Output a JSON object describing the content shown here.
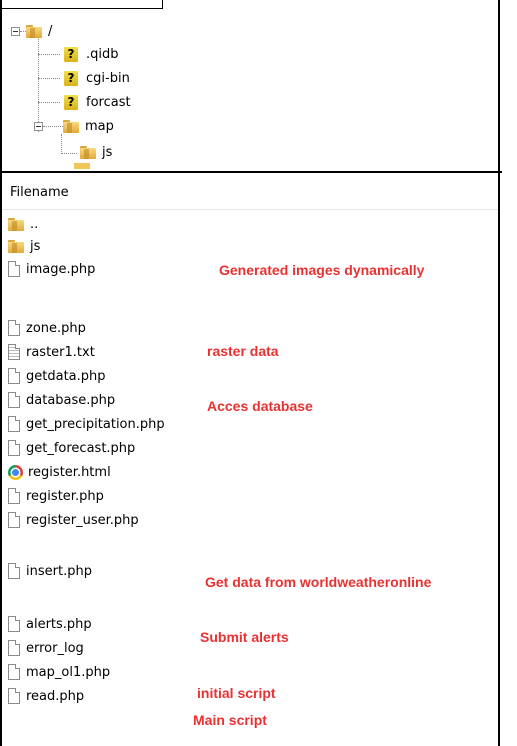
{
  "tree": {
    "root": "/",
    "items": [
      ".qidb",
      "cgi-bin",
      "forcast",
      "map",
      "js"
    ]
  },
  "list": {
    "header": "Filename",
    "files": [
      "..",
      "js",
      "image.php",
      "zone.php",
      "raster1.txt",
      "getdata.php",
      "database.php",
      "get_precipitation.php",
      "get_forecast.php",
      "register.html",
      "register.php",
      "register_user.php",
      "insert.php",
      "alerts.php",
      "error_log",
      "map_ol1.php",
      "read.php"
    ]
  },
  "annotations": {
    "image": "Generated images dynamically",
    "raster": "raster data",
    "database": "Acces database",
    "insert": "Get data from worldweatheronline",
    "alerts": "Submit alerts",
    "map_ol1": "initial script",
    "read": "Main script"
  },
  "colors": {
    "annotation": "#e83232",
    "folder": "#f0c659"
  }
}
